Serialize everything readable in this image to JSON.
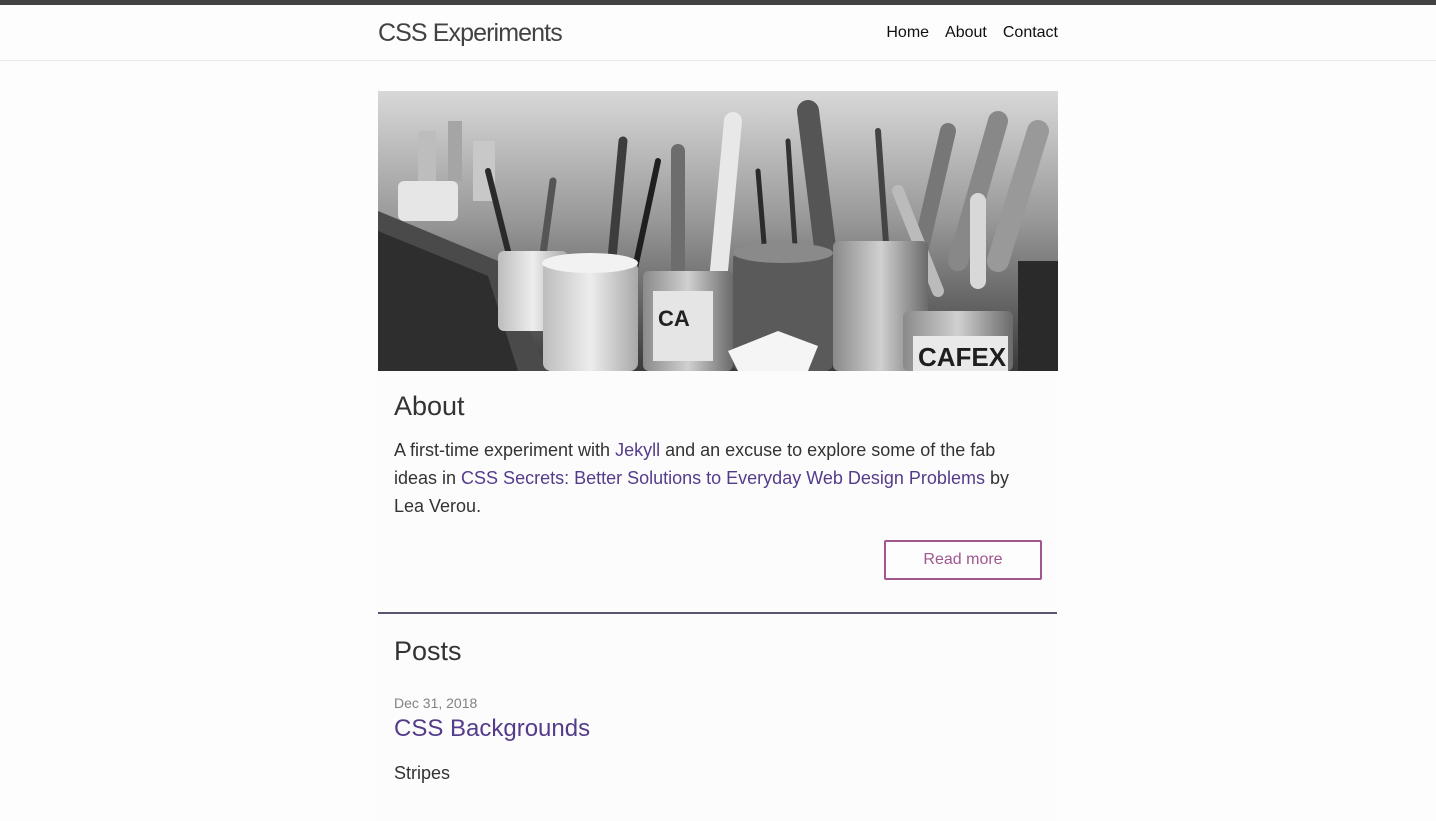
{
  "header": {
    "site_title": "CSS Experiments",
    "nav": [
      "Home",
      "About",
      "Contact"
    ]
  },
  "about": {
    "heading": "About",
    "text_1": "A first-time experiment with ",
    "link_jekyll": "Jekyll",
    "text_2": " and an excuse to explore some of the fab ideas in ",
    "link_book": "CSS Secrets: Better Solutions to Everyday Web Design Problems",
    "text_3": " by Lea Verou.",
    "read_more": "Read more"
  },
  "posts": {
    "heading": "Posts",
    "items": [
      {
        "date": "Dec 31, 2018",
        "title": "CSS Backgrounds",
        "excerpt": "Stripes"
      }
    ]
  },
  "colors": {
    "link": "#553c8b",
    "button": "#a0568e",
    "top_strip": "#424242"
  }
}
